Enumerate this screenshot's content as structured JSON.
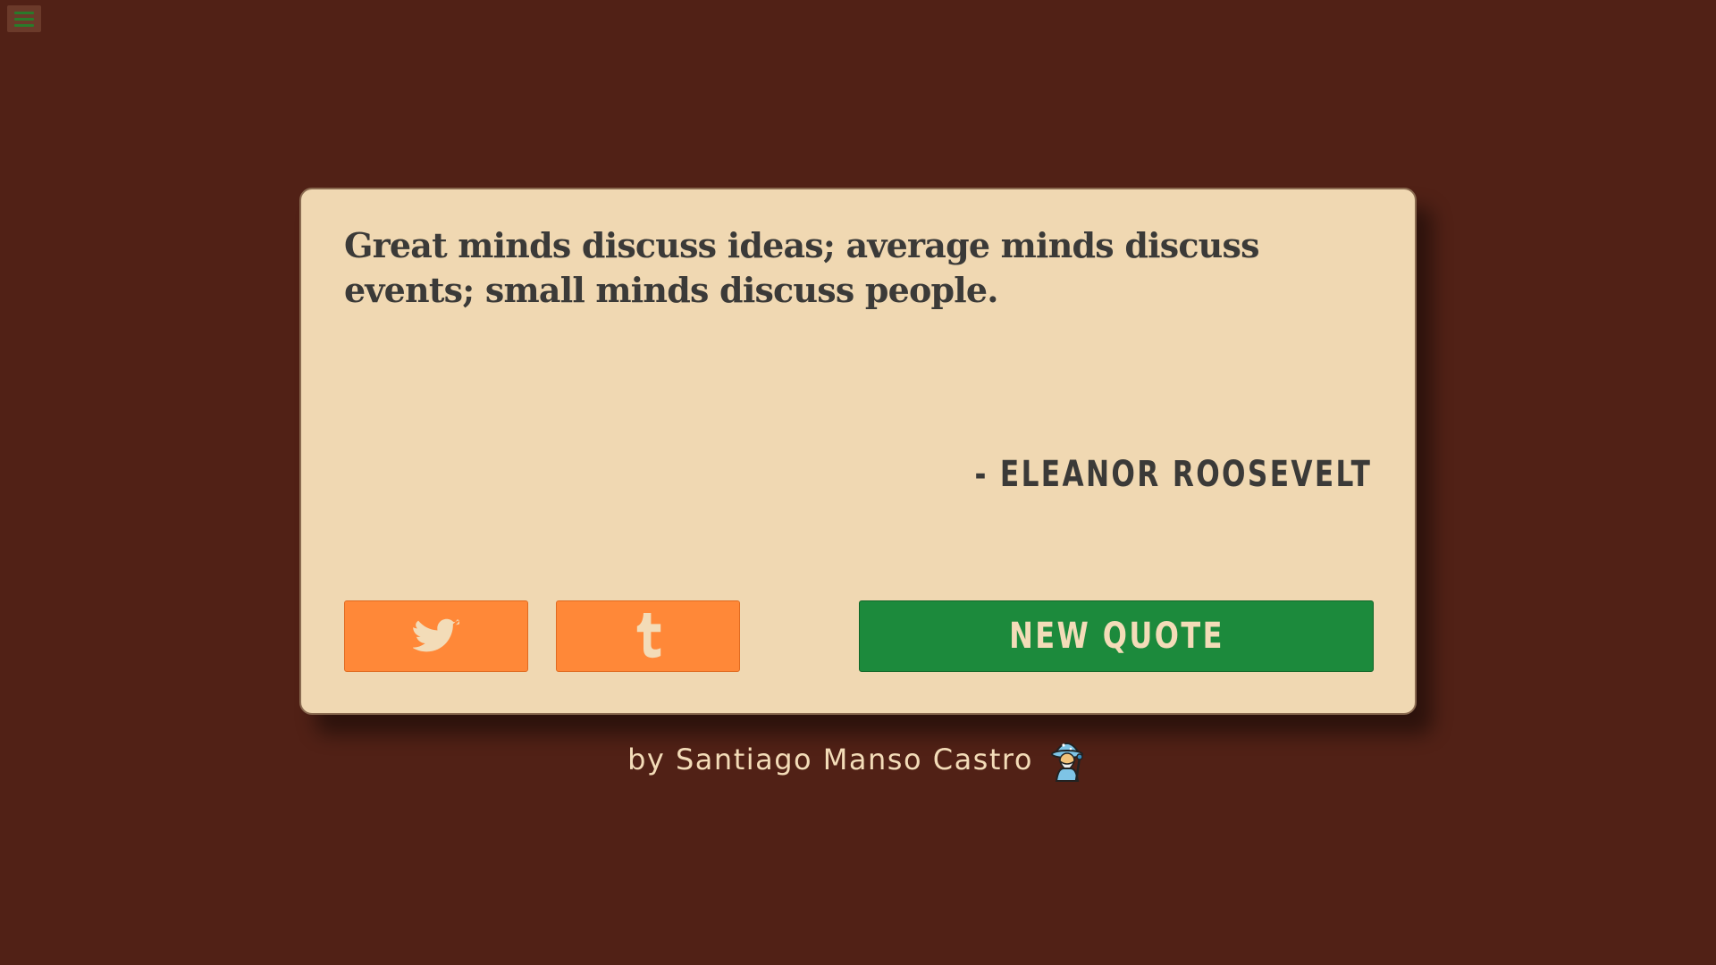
{
  "menu": {
    "icon": "hamburger-icon"
  },
  "quote": {
    "text": "Great minds discuss ideas; average minds discuss events; small minds discuss people.",
    "author": "- ELEANOR ROOSEVELT"
  },
  "actions": {
    "twitter_icon": "twitter-bird-icon",
    "tumblr_icon": "tumblr-t-icon",
    "new_quote_label": "NEW QUOTE"
  },
  "footer": {
    "credit": "by Santiago Manso Castro",
    "emoji_icon": "mage-icon"
  },
  "colors": {
    "background": "#512116",
    "card": "#f0d8b2",
    "text": "#3b3a38",
    "share_button": "#ff8838",
    "new_quote_button": "#1c8a3c",
    "footer_text": "#f3dcb8"
  }
}
